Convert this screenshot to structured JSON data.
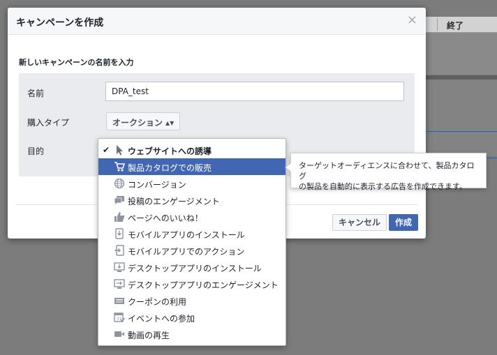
{
  "background": {
    "column_header_end": "終了"
  },
  "dialog": {
    "title": "キャンペーンを作成",
    "close_symbol": "×",
    "prompt": "新しいキャンペーンの名前を入力",
    "fields": {
      "name_label": "名前",
      "name_value": "DPA_test",
      "purchase_type_label": "購入タイプ",
      "purchase_type_value": "オークション",
      "objective_label": "目的"
    },
    "buttons": {
      "cancel": "キャンセル",
      "create": "作成"
    }
  },
  "objective_menu": {
    "items": [
      {
        "label": "ウェブサイトへの誘導",
        "icon": "cursor-icon",
        "selected": true
      },
      {
        "label": "製品カタログでの販売",
        "icon": "cart-icon",
        "highlighted": true
      },
      {
        "label": "コンバージョン",
        "icon": "globe-icon"
      },
      {
        "label": "投稿のエンゲージメント",
        "icon": "comments-icon"
      },
      {
        "label": "ページへのいいね！",
        "icon": "thumbs-up-icon"
      },
      {
        "label": "モバイルアプリのインストール",
        "icon": "mobile-install-icon"
      },
      {
        "label": "モバイルアプリでのアクション",
        "icon": "mobile-action-icon"
      },
      {
        "label": "デスクトップアプリのインストール",
        "icon": "desktop-install-icon"
      },
      {
        "label": "デスクトップアプリのエンゲージメント",
        "icon": "desktop-engage-icon"
      },
      {
        "label": "クーポンの利用",
        "icon": "coupon-icon"
      },
      {
        "label": "イベントへの参加",
        "icon": "event-icon"
      },
      {
        "label": "動画の再生",
        "icon": "video-icon"
      }
    ]
  },
  "tooltip": {
    "line1": "ターゲットオーディエンスに合わせて、製品カタログ",
    "line2": "の製品を自動的に表示する広告を作成できます。"
  },
  "colors": {
    "accent": "#4267b2",
    "icon_gray": "#8d949e"
  }
}
